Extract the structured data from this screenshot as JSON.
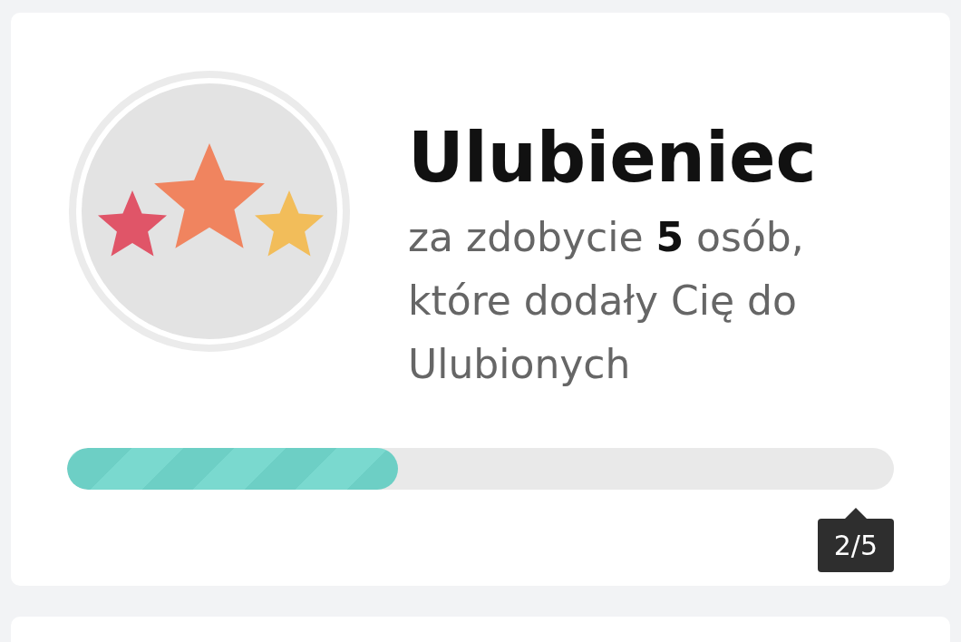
{
  "achievement": {
    "title": "Ulubieniec",
    "description": "za zdobycie **5** osób, które dodały Cię do Ulubionych",
    "progress": {
      "level": 0.4,
      "reading": "2/5"
    }
  }
}
